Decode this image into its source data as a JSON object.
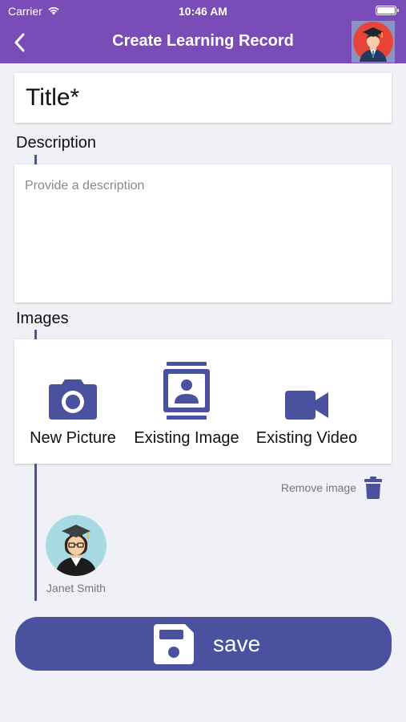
{
  "status_bar": {
    "carrier": "Carrier",
    "time": "10:46 AM",
    "battery_level": 1.0
  },
  "nav": {
    "title": "Create Learning Record",
    "back_icon": "chevron-left-icon",
    "avatar_icon": "graduate-avatar-icon"
  },
  "form": {
    "title_placeholder": "Title*",
    "description_label": "Description",
    "description_placeholder": "Provide a description",
    "images_label": "Images"
  },
  "media_options": [
    {
      "label": "New Picture",
      "icon": "camera-icon"
    },
    {
      "label": "Existing Image",
      "icon": "image-gallery-icon"
    },
    {
      "label": "Existing Video",
      "icon": "video-camera-icon"
    }
  ],
  "remove_image": {
    "label": "Remove image",
    "icon": "trash-icon"
  },
  "attached_person": {
    "name": "Janet Smith"
  },
  "save": {
    "label": "save",
    "icon": "floppy-disk-icon"
  },
  "colors": {
    "nav_purple": "#7a4cb8",
    "accent_blue": "#4a52a0",
    "background": "#f0f1f6"
  }
}
